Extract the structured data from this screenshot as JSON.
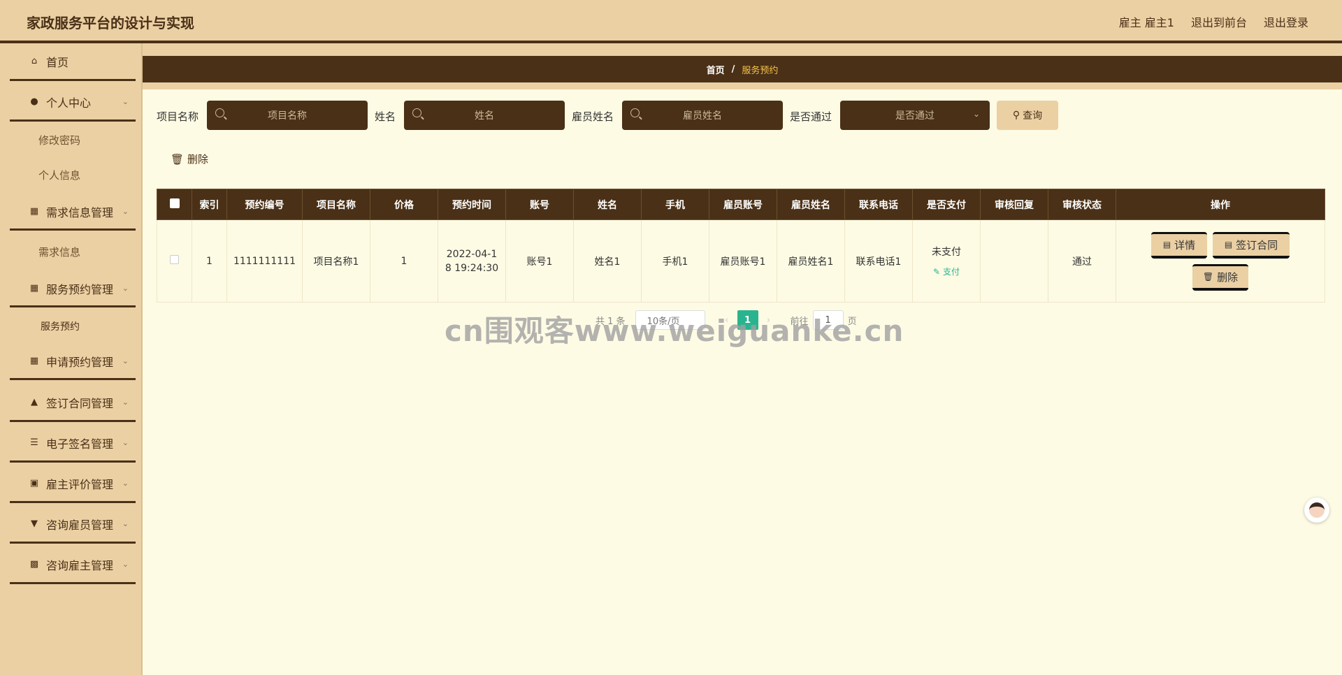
{
  "header": {
    "app_title": "家政服务平台的设计与实现",
    "user_label": "雇主 雇主1",
    "to_front": "退出到前台",
    "logout": "退出登录"
  },
  "sidebar": {
    "items": [
      {
        "label": "首页",
        "icon": "home-icon"
      },
      {
        "label": "个人中心",
        "icon": "user-icon"
      },
      {
        "label": "修改密码"
      },
      {
        "label": "个人信息"
      },
      {
        "label": "需求信息管理",
        "icon": "grid-icon"
      },
      {
        "label": "需求信息"
      },
      {
        "label": "服务预约管理",
        "icon": "grid-icon"
      },
      {
        "label": "服务预约"
      },
      {
        "label": "申请预约管理",
        "icon": "grid-icon"
      },
      {
        "label": "签订合同管理",
        "icon": "stamp-icon"
      },
      {
        "label": "电子签名管理",
        "icon": "list-icon"
      },
      {
        "label": "雇主评价管理",
        "icon": "monitor-icon"
      },
      {
        "label": "咨询雇员管理",
        "icon": "chat-icon"
      },
      {
        "label": "咨询雇主管理",
        "icon": "clipboard-icon"
      }
    ]
  },
  "breadcrumb": {
    "home": "首页",
    "separator": "/",
    "current": "服务预约"
  },
  "search": {
    "f1_label": "项目名称",
    "f1_placeholder": "项目名称",
    "f2_label": "姓名",
    "f2_placeholder": "姓名",
    "f3_label": "雇员姓名",
    "f3_placeholder": "雇员姓名",
    "f4_label": "是否通过",
    "f4_placeholder": "是否通过",
    "query_label": "查询"
  },
  "toolbar": {
    "delete_label": "删除"
  },
  "table": {
    "columns": [
      "索引",
      "预约编号",
      "项目名称",
      "价格",
      "预约时间",
      "账号",
      "姓名",
      "手机",
      "雇员账号",
      "雇员姓名",
      "联系电话",
      "是否支付",
      "审核回复",
      "审核状态",
      "操作"
    ],
    "rows": [
      {
        "index": "1",
        "booking_no": "1111111111",
        "project": "项目名称1",
        "price": "1",
        "time_line1": "2022-04-1",
        "time_line2": "8 19:24:30",
        "account": "账号1",
        "name": "姓名1",
        "phone": "手机1",
        "emp_account": "雇员账号1",
        "emp_name": "雇员姓名1",
        "contact": "联系电话1",
        "paid": "未支付",
        "pay_link": "支付",
        "reply": "",
        "status": "通过",
        "btn_detail": "详情",
        "btn_contract": "签订合同",
        "btn_delete": "删除"
      }
    ]
  },
  "pagination": {
    "total": "共 1 条",
    "page_size": "10条/页",
    "current_page": "1",
    "goto_label": "前往",
    "goto_value": "1",
    "page_unit": "页"
  },
  "watermark": "cn围观客www.weiguanke.cn",
  "colors": {
    "primary_dark": "#4a3016",
    "tan": "#ebd0a4",
    "page_bg": "#fdfbe4",
    "accent_green": "#29b48f",
    "crumb_highlight": "#f6c34d"
  }
}
